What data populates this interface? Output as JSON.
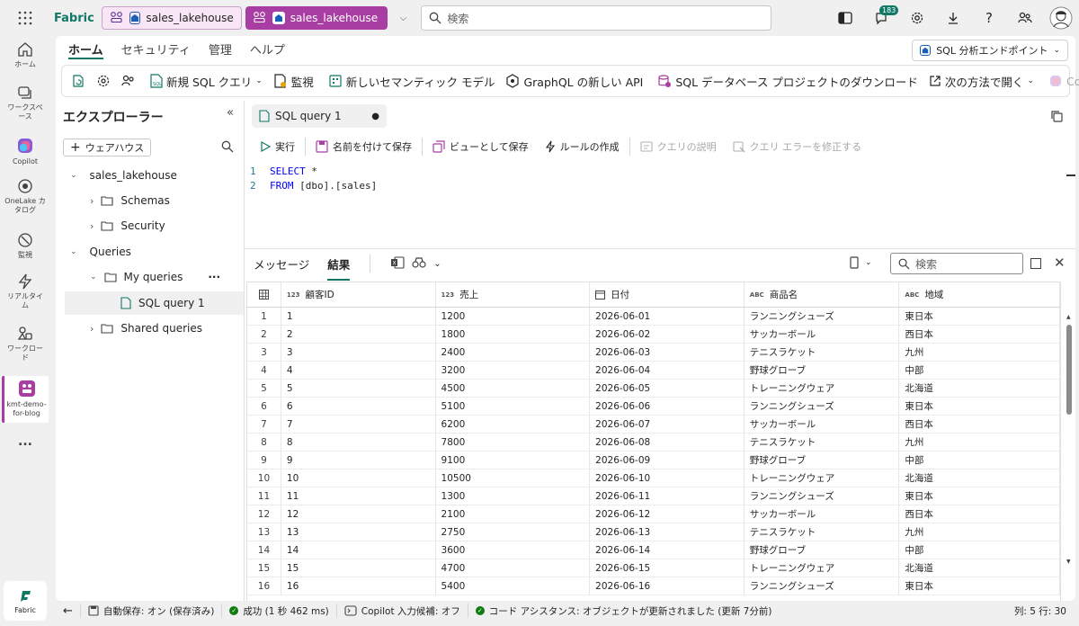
{
  "app": {
    "brand": "Fabric"
  },
  "topbar": {
    "tabs": [
      {
        "label": "sales_lakehouse",
        "active": false
      },
      {
        "label": "sales_lakehouse",
        "active": true
      }
    ],
    "search_placeholder": "検索",
    "notification_count": "183"
  },
  "leftnav": {
    "items": [
      {
        "label": "ホーム",
        "icon": "home-icon"
      },
      {
        "label": "ワークスペース",
        "icon": "workspaces-icon"
      },
      {
        "label": "Copilot",
        "icon": "copilot-icon"
      },
      {
        "label": "OneLake カタログ",
        "icon": "onelake-icon"
      },
      {
        "label": "監視",
        "icon": "monitor-icon"
      },
      {
        "label": "リアルタイム",
        "icon": "realtime-icon"
      },
      {
        "label": "ワークロード",
        "icon": "workloads-icon"
      },
      {
        "label": "kmt-demo-for-blog",
        "icon": "workspace-icon"
      }
    ],
    "more": "...",
    "footer": "Fabric"
  },
  "ribbon_tabs": [
    "ホーム",
    "セキュリティ",
    "管理",
    "ヘルプ"
  ],
  "endpoint_selector": "SQL 分析エンドポイント",
  "ribbon": {
    "new_sql_query": "新規 SQL クエリ",
    "monitor": "監視",
    "new_semantic_model": "新しいセマンティック モデル",
    "graphql": "GraphQL の新しい API",
    "download_project": "SQL データベース プロジェクトのダウンロード",
    "open_in": "次の方法で開く",
    "copilot": "Copilot"
  },
  "explorer": {
    "title": "エクスプローラー",
    "add_warehouse": "ウェアハウス",
    "tree": {
      "lakehouse": "sales_lakehouse",
      "schemas": "Schemas",
      "security": "Security",
      "queries": "Queries",
      "my_queries": "My queries",
      "query1": "SQL query 1",
      "shared": "Shared queries"
    }
  },
  "editor": {
    "tab_label": "SQL query 1",
    "toolbar": {
      "run": "実行",
      "save_as": "名前を付けて保存",
      "save_view": "ビューとして保存",
      "create_rule": "ルールの作成",
      "explain": "クエリの説明",
      "fix": "クエリ エラーを修正する"
    },
    "lines": [
      {
        "num": "1",
        "kw": "SELECT",
        "rest": " *"
      },
      {
        "num": "2",
        "kw": "FROM",
        "rest": " [dbo].[sales]"
      }
    ]
  },
  "results": {
    "tabs": [
      "メッセージ",
      "結果"
    ],
    "search_placeholder": "検索",
    "columns": [
      {
        "type": "123",
        "name": "顧客ID"
      },
      {
        "type": "123",
        "name": "売上"
      },
      {
        "type": "cal",
        "name": "日付"
      },
      {
        "type": "ABC",
        "name": "商品名"
      },
      {
        "type": "ABC",
        "name": "地域"
      }
    ],
    "rows": [
      [
        "1",
        "1",
        "1200",
        "2026-06-01",
        "ランニングシューズ",
        "東日本"
      ],
      [
        "2",
        "2",
        "1800",
        "2026-06-02",
        "サッカーボール",
        "西日本"
      ],
      [
        "3",
        "3",
        "2400",
        "2026-06-03",
        "テニスラケット",
        "九州"
      ],
      [
        "4",
        "4",
        "3200",
        "2026-06-04",
        "野球グローブ",
        "中部"
      ],
      [
        "5",
        "5",
        "4500",
        "2026-06-05",
        "トレーニングウェア",
        "北海道"
      ],
      [
        "6",
        "6",
        "5100",
        "2026-06-06",
        "ランニングシューズ",
        "東日本"
      ],
      [
        "7",
        "7",
        "6200",
        "2026-06-07",
        "サッカーボール",
        "西日本"
      ],
      [
        "8",
        "8",
        "7800",
        "2026-06-08",
        "テニスラケット",
        "九州"
      ],
      [
        "9",
        "9",
        "9100",
        "2026-06-09",
        "野球グローブ",
        "中部"
      ],
      [
        "10",
        "10",
        "10500",
        "2026-06-10",
        "トレーニングウェア",
        "北海道"
      ],
      [
        "11",
        "11",
        "1300",
        "2026-06-11",
        "ランニングシューズ",
        "東日本"
      ],
      [
        "12",
        "12",
        "2100",
        "2026-06-12",
        "サッカーボール",
        "西日本"
      ],
      [
        "13",
        "13",
        "2750",
        "2026-06-13",
        "テニスラケット",
        "九州"
      ],
      [
        "14",
        "14",
        "3600",
        "2026-06-14",
        "野球グローブ",
        "中部"
      ],
      [
        "15",
        "15",
        "4700",
        "2026-06-15",
        "トレーニングウェア",
        "北海道"
      ],
      [
        "16",
        "16",
        "5400",
        "2026-06-16",
        "ランニングシューズ",
        "東日本"
      ]
    ]
  },
  "status": {
    "autosave": "自動保存: オン (保存済み)",
    "success": "成功 (1 秒 462 ms)",
    "copilot": "Copilot 入力候補: オフ",
    "assist": "コード アシスタンス: オブジェクトが更新されました (更新 7分前)",
    "position": "列: 5 行: 30"
  },
  "colors": {
    "accent": "#117865",
    "workspace": "#a83ea3"
  }
}
